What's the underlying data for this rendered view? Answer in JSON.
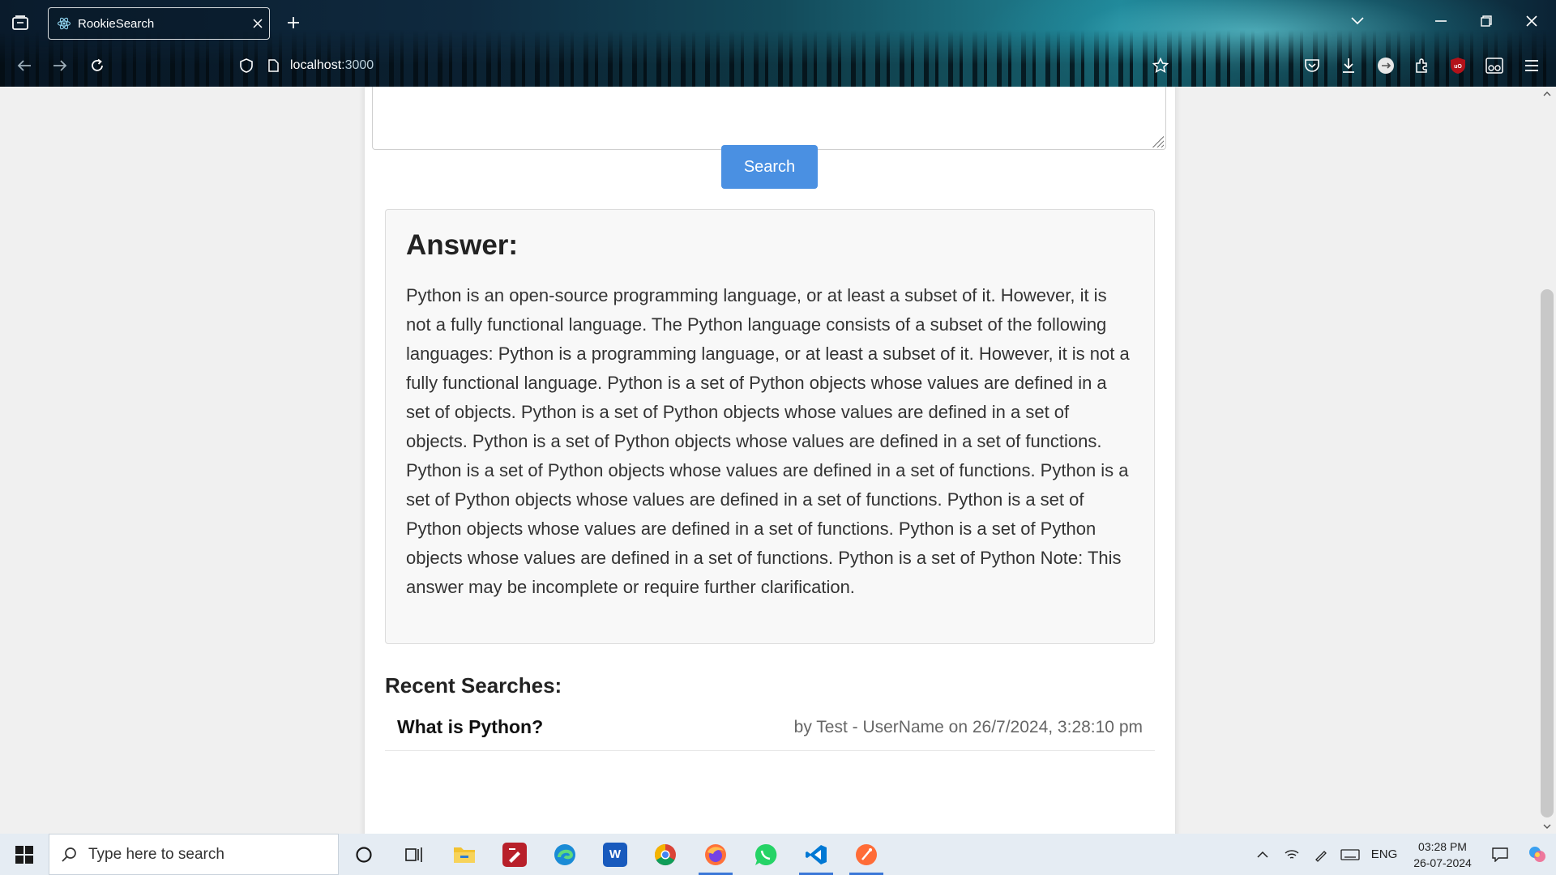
{
  "browser": {
    "tab_title": "RookieSearch",
    "url_host": "localhost",
    "url_port": ":3000",
    "icons": [
      "tab-list-icon",
      "react-favicon-icon",
      "close-icon",
      "plus-icon",
      "chevron-down-icon",
      "minimize-icon",
      "restore-icon",
      "close-window-icon",
      "back-icon",
      "forward-icon",
      "reload-icon",
      "shield-icon",
      "page-icon",
      "star-icon",
      "pocket-icon",
      "download-icon",
      "account-icon",
      "extensions-icon",
      "ublock-icon",
      "reader-icon",
      "menu-icon"
    ]
  },
  "app": {
    "search_button": "Search",
    "answer_heading": "Answer:",
    "answer_text": "Python is an open-source programming language, or at least a subset of it. However, it is not a fully functional language. The Python language consists of a subset of the following languages: Python is a programming language, or at least a subset of it. However, it is not a fully functional language. Python is a set of Python objects whose values are defined in a set of objects. Python is a set of Python objects whose values are defined in a set of objects. Python is a set of Python objects whose values are defined in a set of functions. Python is a set of Python objects whose values are defined in a set of functions. Python is a set of Python objects whose values are defined in a set of functions. Python is a set of Python objects whose values are defined in a set of functions. Python is a set of Python objects whose values are defined in a set of functions. Python is a set of Python Note: This answer may be incomplete or require further clarification.",
    "recent_heading": "Recent Searches:",
    "recent_items": [
      {
        "query": "What is Python?",
        "meta": "by Test - UserName on 26/7/2024, 3:28:10 pm"
      }
    ]
  },
  "taskbar": {
    "search_placeholder": "Type here to search",
    "apps": [
      "cortana-icon",
      "task-view-icon",
      "file-explorer-icon",
      "pdf-app-icon",
      "edge-icon",
      "word-icon",
      "chrome-icon",
      "firefox-icon",
      "whatsapp-icon",
      "vscode-icon",
      "postman-icon"
    ],
    "language": "ENG",
    "time": "03:28 PM",
    "date": "26-07-2024"
  },
  "colors": {
    "accent_button": "#4a90e2",
    "taskbar_bg": "#e5ecf3",
    "page_bg": "#f0f0f0"
  }
}
